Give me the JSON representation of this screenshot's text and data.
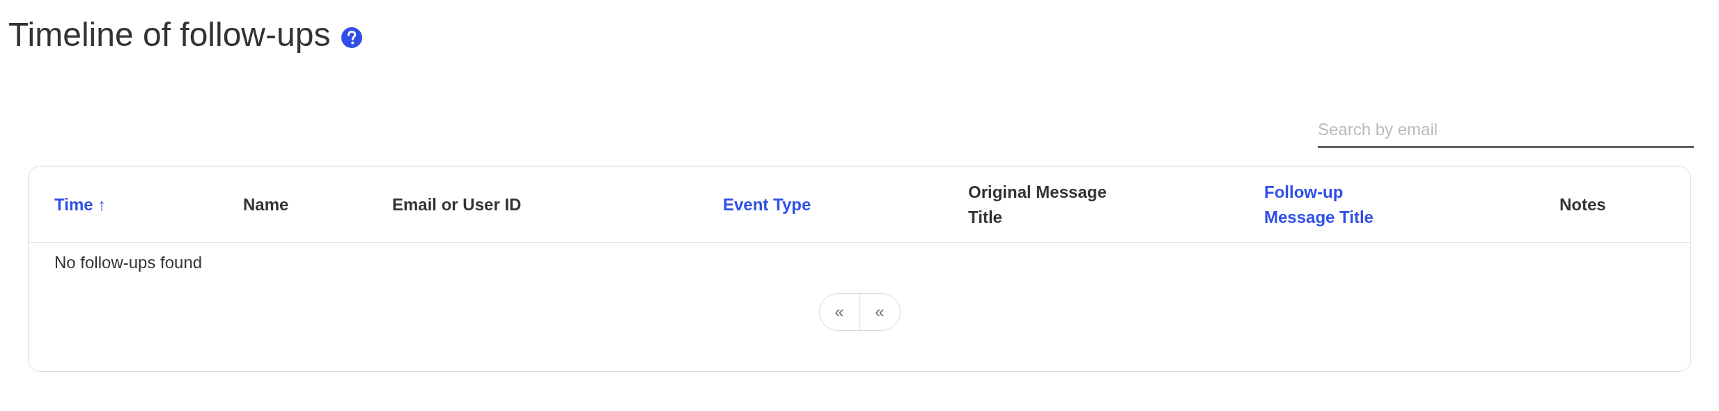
{
  "title": "Timeline of follow-ups",
  "search": {
    "placeholder": "Search by email"
  },
  "table": {
    "columns": [
      {
        "label": "Time ↑",
        "sortable": true
      },
      {
        "label": "Name",
        "sortable": false
      },
      {
        "label": "Email or User ID",
        "sortable": false
      },
      {
        "label": "Event Type",
        "sortable": true
      },
      {
        "label": "Original Message Title",
        "sortable": false
      },
      {
        "label": "Follow-up Message Title",
        "sortable": true
      },
      {
        "label": "Notes",
        "sortable": false
      }
    ],
    "empty_message": "No follow-ups found"
  },
  "pagination": [
    "«",
    "«"
  ]
}
